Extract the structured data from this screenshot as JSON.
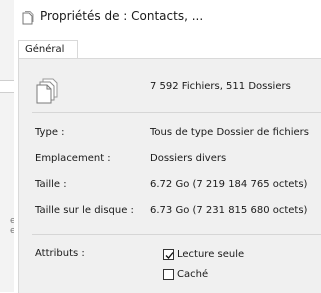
{
  "window": {
    "title": "Propriétés de : Contacts, ..."
  },
  "tabs": [
    {
      "label": "Général"
    }
  ],
  "summary": {
    "count": "7 592 Fichiers, 511 Dossiers"
  },
  "props": {
    "type": {
      "label": "Type :",
      "value": "Tous de type Dossier de fichiers"
    },
    "location": {
      "label": "Emplacement :",
      "value": "Dossiers divers"
    },
    "size": {
      "label": "Taille :",
      "value": "6.72 Go (7 219 184 765 octets)"
    },
    "disk_size": {
      "label": "Taille sur le disque :",
      "value": "6.73 Go (7 231 815 680 octets)"
    }
  },
  "attributes": {
    "label": "Attributs :",
    "readonly": {
      "label": "Lecture seule",
      "checked": true
    },
    "hidden": {
      "label": "Caché",
      "checked": false
    }
  },
  "left_pane": {
    "mark": "e"
  },
  "icons": {
    "title": "folder-icon",
    "files": "files-icon",
    "check": "checkmark-icon"
  },
  "colors": {
    "panel": "#f0f0f0",
    "separator": "#d6d6d6"
  }
}
